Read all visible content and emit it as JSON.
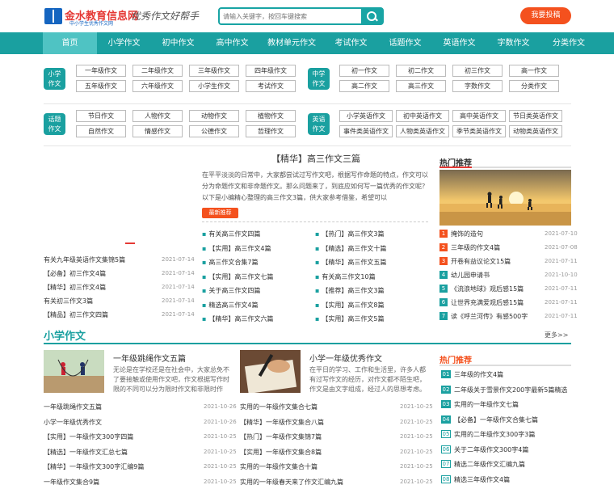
{
  "header": {
    "logo_text": "金水教育信息网",
    "logo_sub": "中小学生优秀作文网",
    "slogan": "优秀作文好帮手",
    "search_placeholder": "请输入关键字，按回车键搜索",
    "submit_label": "我要投稿"
  },
  "nav": [
    "首页",
    "小学作文",
    "初中作文",
    "高中作文",
    "教材单元作文",
    "考试作文",
    "话题作文",
    "英语作文",
    "字数作文",
    "分类作文"
  ],
  "cats": {
    "primary": {
      "label": [
        "小学",
        "作文"
      ],
      "items": [
        "一年级作文",
        "二年级作文",
        "三年级作文",
        "四年级作文",
        "五年级作文",
        "六年级作文",
        "小学生作文",
        "考试作文"
      ]
    },
    "middle": {
      "label": [
        "中学",
        "作文"
      ],
      "items": [
        "初一作文",
        "初二作文",
        "初三作文",
        "高一作文",
        "高二作文",
        "高三作文",
        "字数作文",
        "分类作文"
      ]
    },
    "topic": {
      "label": [
        "话题",
        "作文"
      ],
      "items": [
        "节日作文",
        "人物作文",
        "动物作文",
        "植物作文",
        "自然作文",
        "情感作文",
        "公德作文",
        "哲理作文"
      ]
    },
    "english": {
      "label": [
        "英语",
        "作文"
      ],
      "items": [
        "小学英语作文",
        "初中英语作文",
        "高中英语作文",
        "节日类英语作文",
        "事件类英语作文",
        "人物类英语作文",
        "季节类英语作文",
        "动物类英语作文"
      ]
    }
  },
  "featured": {
    "title": "【精华】高三作文三篇",
    "text": "在平平淡淡的日常中，大家都尝试过写作文吧，根据写作命题的特点，作文可以分为命题作文和非命题作文。那么问题来了，到底应如何写一篇优秀的作文呢？以下是小编精心整理的高三作文3篇，供大家参考借鉴，希望可以",
    "tag": "最新推荐"
  },
  "left_list": [
    {
      "title": "有关九年级英语作文集锦5篇",
      "date": "2021-07-14"
    },
    {
      "title": "【必备】初三作文4篇",
      "date": "2021-07-14"
    },
    {
      "title": "【精华】初三作文4篇",
      "date": "2021-07-14"
    },
    {
      "title": "有关初三作文3篇",
      "date": "2021-07-14"
    },
    {
      "title": "【精品】初三作文四篇",
      "date": "2021-07-14"
    }
  ],
  "mid_list_a": [
    "有关高三作文四篇",
    "【实用】高三作文4篇",
    "高三作文合集7篇",
    "【实用】高三作文七篇",
    "关于高三作文四篇",
    "精选高三作文4篇",
    "【精华】高三作文六篇"
  ],
  "mid_list_b": [
    "【热门】高三作文3篇",
    "【精选】高三作文十篇",
    "【精华】高三作文五篇",
    "有关高三作文10篇",
    "【推荐】高三作文3篇",
    "【实用】高三作文8篇",
    "【实用】高三作文5篇"
  ],
  "hot1": {
    "title": "热门推荐",
    "items": [
      {
        "n": "1",
        "title": "掩饰的造句",
        "date": "2021-07-10"
      },
      {
        "n": "2",
        "title": "三年级的作文4篇",
        "date": "2021-07-08"
      },
      {
        "n": "3",
        "title": "开卷有益议论文15篇",
        "date": "2021-07-11"
      },
      {
        "n": "4",
        "title": "幼儿园申请书",
        "date": "2021-10-10"
      },
      {
        "n": "5",
        "title": "《流浪地球》观后感15篇",
        "date": "2021-07-11"
      },
      {
        "n": "6",
        "title": "让世界充满爱观后感15篇",
        "date": "2021-07-11"
      },
      {
        "n": "7",
        "title": "读《呼兰河传》有感500字",
        "date": "2021-07-11"
      }
    ]
  },
  "section": {
    "title": "小学作文",
    "more": "更多>>"
  },
  "card1": {
    "title": "一年级跳绳作文五篇",
    "text": "无论是在学校还是在社会中，大家总免不了要接触或使用作文吧，作文根据写作时限的不同可以分为限时作文和非限时作文。"
  },
  "card2": {
    "title": "小学一年级优秀作文",
    "text": "在平日的学习、工作和生活里，许多人都有过写作文的经历，对作文都不陌生吧，作文是由文字组成，经过人的思想考虑。"
  },
  "list1": [
    {
      "title": "一年级跳绳作文五篇",
      "date": "2021-10-26"
    },
    {
      "title": "小学一年级优秀作文",
      "date": "2021-10-26"
    },
    {
      "title": "【实用】一年级作文300字四篇",
      "date": "2021-10-25"
    },
    {
      "title": "【精选】一年级作文汇总七篇",
      "date": "2021-10-25"
    },
    {
      "title": "【精华】一年级作文300字汇编9篇",
      "date": "2021-10-25"
    },
    {
      "title": "一年级作文集合9篇",
      "date": "2021-10-25"
    }
  ],
  "list2": [
    {
      "title": "实用的一年级作文集合七篇",
      "date": "2021-10-25"
    },
    {
      "title": "【精华】一年级作文集合八篇",
      "date": "2021-10-25"
    },
    {
      "title": "【热门】一年级作文集锦7篇",
      "date": "2021-10-25"
    },
    {
      "title": "【实用】一年级作文集合8篇",
      "date": "2021-10-25"
    },
    {
      "title": "实用的一年级作文集合十篇",
      "date": "2021-10-25"
    },
    {
      "title": "实用的一年级春天来了作文汇编九篇",
      "date": "2021-10-25"
    }
  ],
  "hot2": {
    "title": "热门推荐",
    "items": [
      {
        "n": "01",
        "title": "三年级的作文4篇"
      },
      {
        "n": "02",
        "title": "二年级关于雪景作文200字最新5篇精选"
      },
      {
        "n": "03",
        "title": "实用的一年级作文七篇"
      },
      {
        "n": "04",
        "title": "【必备】一年级作文合集七篇"
      },
      {
        "n": "05",
        "title": "实用的二年级作文300字3篇"
      },
      {
        "n": "06",
        "title": "关于二年级作文300字4篇"
      },
      {
        "n": "07",
        "title": "精选二年级作文汇编九篇"
      },
      {
        "n": "08",
        "title": "精选三年级作文4篇"
      }
    ]
  }
}
